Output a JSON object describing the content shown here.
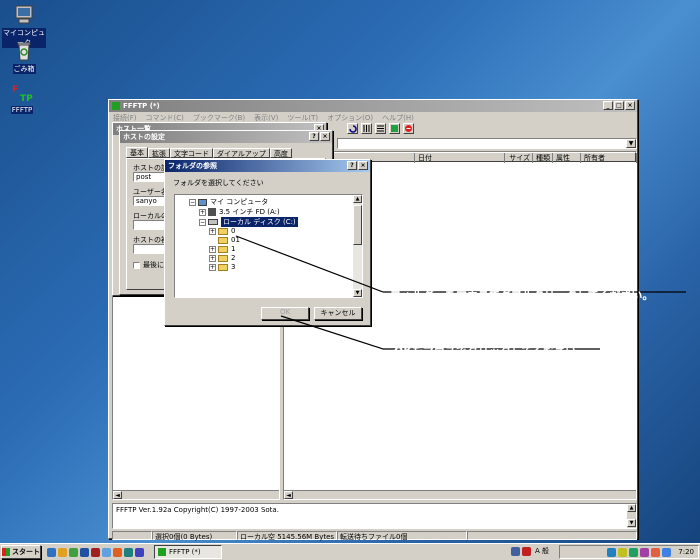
{
  "desktop": {
    "icons": [
      {
        "label": "マイコンピュータ"
      },
      {
        "label": "ごみ箱"
      },
      {
        "label": "FFFTP"
      }
    ]
  },
  "ffftp": {
    "title": "FFFTP (*)",
    "menu": [
      "接続(F)",
      "コマンド(C)",
      "ブックマーク(B)",
      "表示(V)",
      "ツール(T)",
      "オプション(O)",
      "ヘルプ(H)"
    ],
    "columns": [
      "日付",
      "サイズ",
      "種類",
      "属性",
      "所有者"
    ],
    "log": "FFFTP Ver.1.92a Copyright(C) 1997-2003 Sota.",
    "status": {
      "selected": "選択0個(0 Bytes)",
      "local_free": "ローカル空 5145.56M Bytes",
      "pending": "転送待ちファイル0個"
    }
  },
  "host_list": {
    "title": "ホスト一覧"
  },
  "host_settings": {
    "title": "ホストの設定",
    "tabs": [
      "基本",
      "拡張",
      "文字コード",
      "ダイアルアップ",
      "高度"
    ],
    "labels": {
      "host_name": "ホストの設定",
      "username": "ユーザー名(U",
      "local_init": "ローカルの初",
      "host_init": "ホストの初期",
      "last_folder": "最後にフ"
    },
    "values": {
      "host": "post",
      "user": "sanyo"
    }
  },
  "folder_dialog": {
    "title": "フォルダの参照",
    "prompt": "フォルダを選択してください",
    "tree": {
      "root": "マイ コンピュータ",
      "floppy": "3.5 インチ FD (A:)",
      "local": "ローカル ディスク (C:)",
      "children": [
        "0",
        "01",
        "1",
        "2",
        "3"
      ]
    },
    "ok_label": "OK",
    "cancel_label": "キャンセル"
  },
  "callouts": {
    "double_click": "フォルダーをマウスでダブルクリックしてください。",
    "click_ok": "OKをマウスでクリックしてください。"
  },
  "taskbar": {
    "start": "スタート",
    "task": "FFFTP (*)",
    "ime": "A 般",
    "clock": "7:20"
  }
}
